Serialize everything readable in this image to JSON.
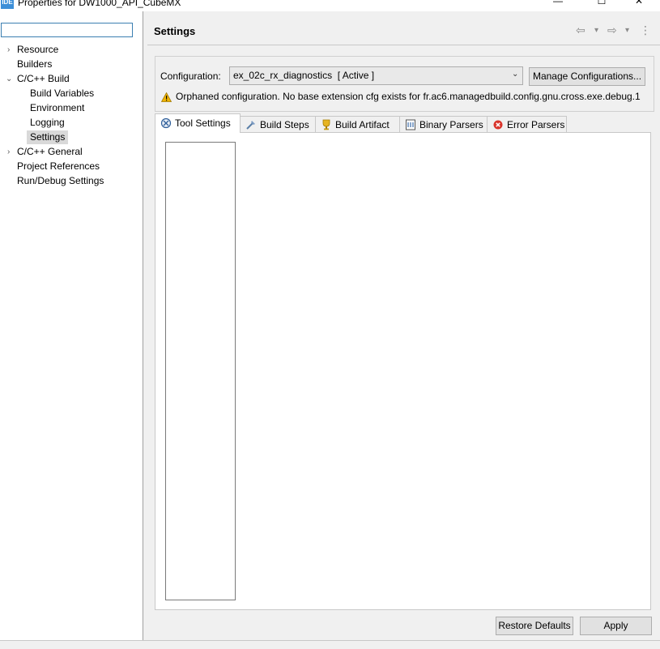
{
  "window": {
    "title": "Properties for DW1000_API_CubeMX",
    "app_icon_text": "IDE",
    "minimize": "—",
    "maximize": "☐",
    "close": "✕"
  },
  "sidebar": {
    "filter_value": "",
    "items": [
      {
        "label": "Resource",
        "expandable": true,
        "expanded": false
      },
      {
        "label": "Builders"
      },
      {
        "label": "C/C++ Build",
        "expandable": true,
        "expanded": true
      },
      {
        "label": "Build Variables"
      },
      {
        "label": "Environment"
      },
      {
        "label": "Logging"
      },
      {
        "label": "Settings",
        "selected": true
      },
      {
        "label": "C/C++ General",
        "expandable": true,
        "expanded": false
      },
      {
        "label": "Project References"
      },
      {
        "label": "Run/Debug Settings"
      }
    ]
  },
  "header": {
    "title": "Settings",
    "back_icon": "⇦",
    "forward_icon": "⇨",
    "dropdown_icon": "▾",
    "menu_icon": "⋮"
  },
  "configuration": {
    "label": "Configuration:",
    "value": "ex_02c_rx_diagnostics  [ Active ]",
    "manage_label": "Manage Configurations...",
    "warning": "Orphaned configuration. No base extension cfg exists for fr.ac6.managedbuild.config.gnu.cross.exe.debug.1"
  },
  "tabs": [
    {
      "label": "Tool Settings",
      "icon": "tool-settings-icon",
      "active": true
    },
    {
      "label": "Build Steps",
      "icon": "build-steps-icon"
    },
    {
      "label": "Build Artifact",
      "icon": "trophy-icon"
    },
    {
      "label": "Binary Parsers",
      "icon": "binary-icon"
    },
    {
      "label": "Error Parsers",
      "icon": "error-icon"
    }
  ],
  "footer": {
    "restore_label": "Restore Defaults",
    "apply_label": "Apply"
  },
  "colors": {
    "accent": "#3c7fb1",
    "warning": "#f0b400",
    "error": "#d9342b",
    "selection": "#d9d9d9"
  }
}
